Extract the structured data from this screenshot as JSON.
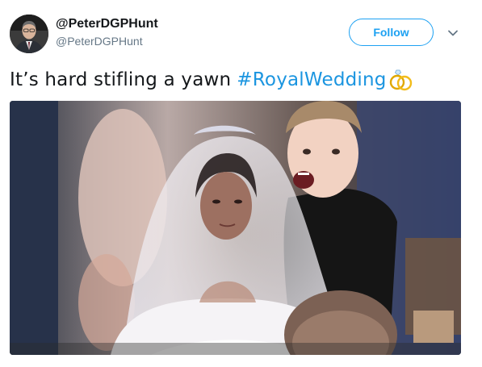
{
  "user": {
    "display_name": "@PeterDGPHunt",
    "handle": "@PeterDGPHunt"
  },
  "actions": {
    "follow_label": "Follow"
  },
  "tweet": {
    "text": "It’s hard stifling a yawn",
    "hashtag": "#RoyalWedding",
    "hashtag_icon": "wedding-rings-icon"
  },
  "icons": {
    "more_menu": "chevron-down-icon",
    "avatar": "avatar"
  },
  "colors": {
    "brand_blue": "#1da1f2",
    "hashtag_blue": "#1b95e0",
    "text_primary": "#14171a",
    "text_secondary": "#657786"
  }
}
